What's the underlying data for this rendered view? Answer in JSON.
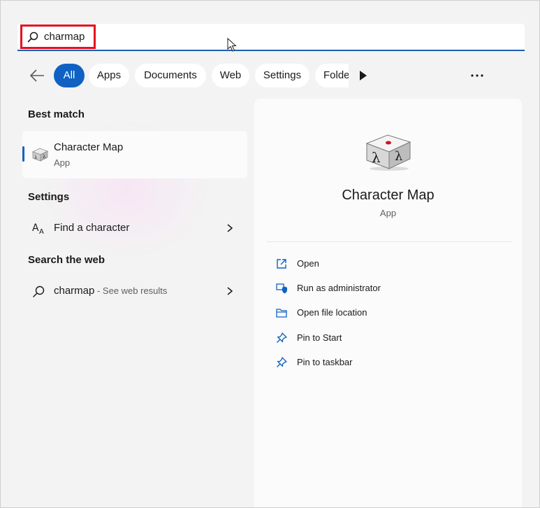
{
  "search": {
    "value": "charmap",
    "highlight_color": "#e3101f",
    "underline_color": "#1c5fb5"
  },
  "filters": {
    "active_color": "#0f62c4",
    "items": [
      {
        "label": "All",
        "active": true
      },
      {
        "label": "Apps"
      },
      {
        "label": "Documents"
      },
      {
        "label": "Web"
      },
      {
        "label": "Settings"
      },
      {
        "label": "Folders"
      }
    ],
    "more_icon": "more-horizontal-icon",
    "scroll_icon": "play-right-icon",
    "back_icon": "arrow-left-icon"
  },
  "best_match": {
    "section_title": "Best match",
    "name": "Character Map",
    "type": "App",
    "icon": "character-map-icon"
  },
  "settings": {
    "section_title": "Settings",
    "item_label": "Find a character",
    "icon": "font-size-icon"
  },
  "web": {
    "section_title": "Search the web",
    "query": "charmap",
    "suffix": " - See web results",
    "icon": "search-icon"
  },
  "details": {
    "name": "Character Map",
    "type": "App",
    "actions": [
      {
        "label": "Open",
        "icon": "open-external-icon"
      },
      {
        "label": "Run as administrator",
        "icon": "shield-icon"
      },
      {
        "label": "Open file location",
        "icon": "folder-icon"
      },
      {
        "label": "Pin to Start",
        "icon": "pin-icon"
      },
      {
        "label": "Pin to taskbar",
        "icon": "pin-icon"
      }
    ]
  }
}
